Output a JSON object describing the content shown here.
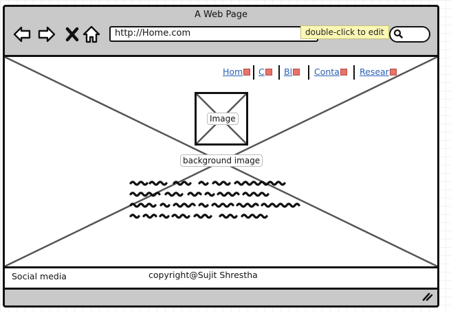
{
  "window": {
    "title": "A Web Page"
  },
  "toolbar": {
    "url": "http://Home.com",
    "tooltip": "double-click to edit",
    "icons": [
      "back-arrow-icon",
      "forward-arrow-icon",
      "close-x-icon",
      "home-icon",
      "search-icon"
    ]
  },
  "nav": {
    "links": [
      {
        "label": "Hom"
      },
      {
        "label": "C"
      },
      {
        "label": "Bl"
      },
      {
        "label": "Conta"
      },
      {
        "label": "Resear"
      }
    ]
  },
  "main": {
    "image_label": "Image",
    "background_label": "background image"
  },
  "footer": {
    "social": "Social media",
    "copyright": "copyright@Sujit Shrestha"
  },
  "colors": {
    "chrome": "#c9c9c9",
    "link": "#2a5fb5",
    "tooltip_bg": "#fbf7b4",
    "stroke": "#111111"
  }
}
